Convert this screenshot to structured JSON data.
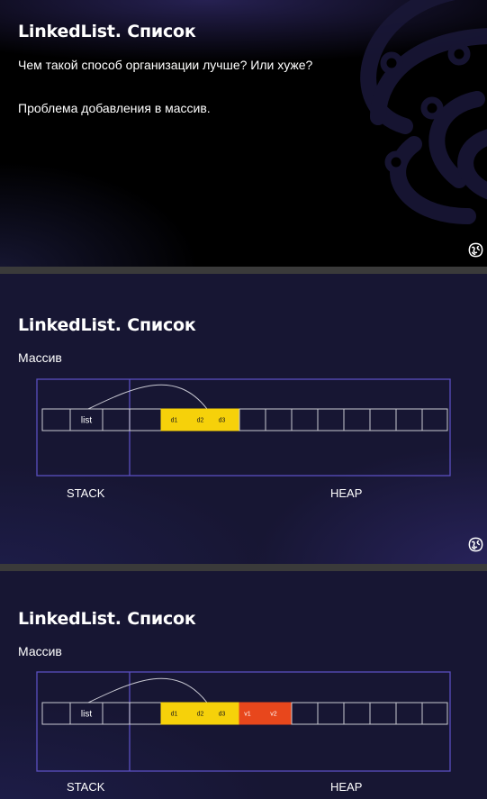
{
  "slides": [
    {
      "title": "LinkedList. Список",
      "lines": [
        "Чем такой способ организации лучше? Или хуже?",
        "Проблема добавления в массив."
      ]
    },
    {
      "title": "LinkedList. Список",
      "subtitle": "Массив",
      "diagram": {
        "pointer_label": "list",
        "cells": [
          "d1",
          "d2",
          "d3"
        ],
        "stack_label": "STACK",
        "heap_label": "HEAP"
      }
    },
    {
      "title": "LinkedList. Список",
      "subtitle": "Массив",
      "diagram": {
        "pointer_label": "list",
        "cells": [
          "d1",
          "d2",
          "d3",
          "v1",
          "v2"
        ],
        "stack_label": "STACK",
        "heap_label": "HEAP"
      }
    }
  ],
  "colors": {
    "old_cells": "#f6d10a",
    "new_cells": "#e8471c",
    "frame": "#5a4fc0"
  },
  "icons": {
    "corner_logo": "brain-logo-icon",
    "background_emblem": "brain-emblem"
  }
}
